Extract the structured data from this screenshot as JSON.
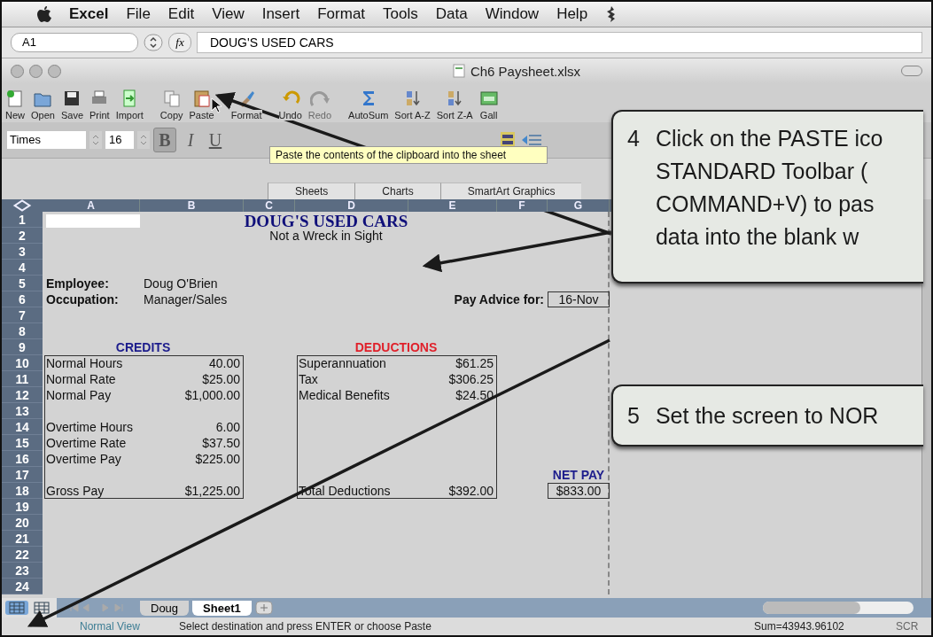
{
  "menu_bar": {
    "app": "Excel",
    "items": [
      "File",
      "Edit",
      "View",
      "Insert",
      "Format",
      "Tools",
      "Data",
      "Window",
      "Help"
    ]
  },
  "formula_bar": {
    "name_box": "A1",
    "fx": "fx",
    "value": "DOUG'S USED CARS"
  },
  "window": {
    "title": "Ch6 Paysheet.xlsx"
  },
  "toolbar": [
    {
      "label": "New",
      "disabled": false
    },
    {
      "label": "Open",
      "disabled": false
    },
    {
      "label": "Save",
      "disabled": false
    },
    {
      "label": "Print",
      "disabled": false
    },
    {
      "label": "Import",
      "disabled": false
    },
    {
      "label": "Copy",
      "disabled": false
    },
    {
      "label": "Paste",
      "disabled": false
    },
    {
      "label": "Format",
      "disabled": false
    },
    {
      "label": "Undo",
      "disabled": false
    },
    {
      "label": "Redo",
      "disabled": true
    },
    {
      "label": "AutoSum",
      "disabled": false
    },
    {
      "label": "Sort A-Z",
      "disabled": false
    },
    {
      "label": "Sort Z-A",
      "disabled": false
    },
    {
      "label": "Gall",
      "disabled": false
    }
  ],
  "format_bar": {
    "font": "Times",
    "size": "16",
    "buttons": [
      {
        "label": "B",
        "selected": true
      },
      {
        "label": "I",
        "selected": false
      },
      {
        "label": "U",
        "selected": false
      }
    ]
  },
  "tooltip": "Paste the contents of the clipboard into the sheet",
  "ribbon_tabs": [
    {
      "label": "Sheets"
    },
    {
      "label": "Charts"
    },
    {
      "label": "SmartArt Graphics"
    }
  ],
  "sheet": {
    "columns": [
      "A",
      "B",
      "C",
      "D",
      "E",
      "F",
      "G"
    ],
    "rows": [
      "1",
      "2",
      "3",
      "4",
      "5",
      "6",
      "7",
      "8",
      "9",
      "10",
      "11",
      "12",
      "13",
      "14",
      "15",
      "16",
      "17",
      "18",
      "19",
      "20",
      "21",
      "22",
      "23",
      "24"
    ],
    "title": "DOUG'S USED CARS",
    "subtitle": "Not a Wreck in Sight",
    "details": [
      {
        "label": "Employee:",
        "value": "Doug O'Brien"
      },
      {
        "label": "Occupation:",
        "value": "Manager/Sales"
      }
    ],
    "pay_advice": {
      "label": "Pay Advice for:",
      "value": "16-Nov"
    },
    "credits": {
      "heading": "CREDITS",
      "color": "#1c1c8c",
      "groups": [
        [
          {
            "label": "Normal Hours",
            "value": "40.00"
          },
          {
            "label": "Normal Rate",
            "value": "$25.00"
          },
          {
            "label": "Normal Pay",
            "value": "$1,000.00"
          }
        ],
        [
          {
            "label": "Overtime Hours",
            "value": "6.00"
          },
          {
            "label": "Overtime Rate",
            "value": "$37.50"
          },
          {
            "label": "Overtime Pay",
            "value": "$225.00"
          }
        ],
        [
          {
            "label": "Gross Pay",
            "value": "$1,225.00"
          }
        ]
      ]
    },
    "deductions": {
      "heading": "DEDUCTIONS",
      "color": "#e0202a",
      "items": [
        {
          "label": "Superannuation",
          "value": "$61.25"
        },
        {
          "label": "Tax",
          "value": "$306.25"
        },
        {
          "label": "Medical Benefits",
          "value": "$24.50"
        }
      ],
      "total": {
        "label": "Total Deductions",
        "value": "$392.00"
      }
    },
    "net_pay": {
      "heading": "NET PAY",
      "value": "$833.00"
    }
  },
  "view_buttons": [
    {
      "selected": true
    },
    {
      "selected": false
    }
  ],
  "sheet_tabs": [
    {
      "label": "Doug",
      "selected": false
    },
    {
      "label": "Sheet1",
      "selected": true
    }
  ],
  "status_bar": {
    "view": "Normal View",
    "message": "Select destination and press ENTER or choose Paste",
    "sum": "Sum=43943.96102",
    "mode": "SCR"
  },
  "callouts": [
    {
      "number": "4",
      "text": "Click on the PASTE ico\nSTANDARD Toolbar (\nCOMMAND+V) to pas\ndata into the blank w"
    },
    {
      "number": "5",
      "text": "Set the screen to NOR"
    }
  ]
}
